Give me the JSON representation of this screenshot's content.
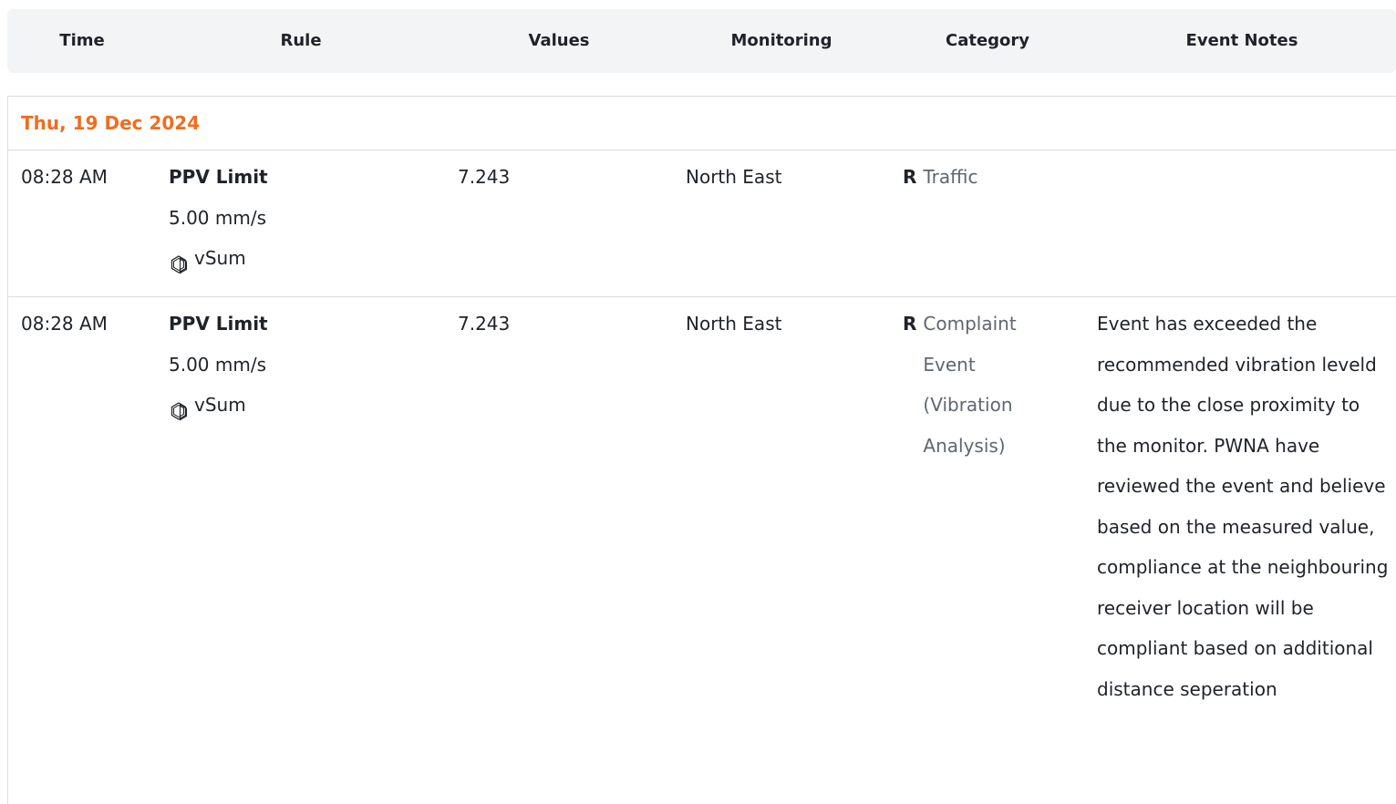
{
  "header": {
    "columns": [
      "Time",
      "Rule",
      "Values",
      "Monitoring",
      "Category",
      "Event Notes"
    ]
  },
  "groups": [
    {
      "date": "Thu, 19 Dec 2024",
      "rows": [
        {
          "time": "08:28 AM",
          "rule_name": "PPV Limit",
          "rule_limit": "5.00 mm/s",
          "rule_sum": "vSum",
          "value": "7.243",
          "monitoring": "North East",
          "category_code": "R",
          "category": "Traffic",
          "notes": ""
        },
        {
          "time": "08:28 AM",
          "rule_name": "PPV Limit",
          "rule_limit": "5.00 mm/s",
          "rule_sum": "vSum",
          "value": "7.243",
          "monitoring": "North East",
          "category_code": "R",
          "category": "Complaint Event (Vibration Analysis)",
          "notes": "Event has exceeded the recommended vibration leveld due to the close proximity to the monitor. PWNA have reviewed the event and believe based on the measured value, compliance at the neighbouring receiver location will be compliant based on additional distance seperation"
        }
      ]
    }
  ],
  "colors": {
    "date_accent": "#f26c1f",
    "header_bg": "#f3f4f6",
    "border": "#d9dce1"
  },
  "icons": {
    "sum": "hexagon-stack-icon"
  }
}
